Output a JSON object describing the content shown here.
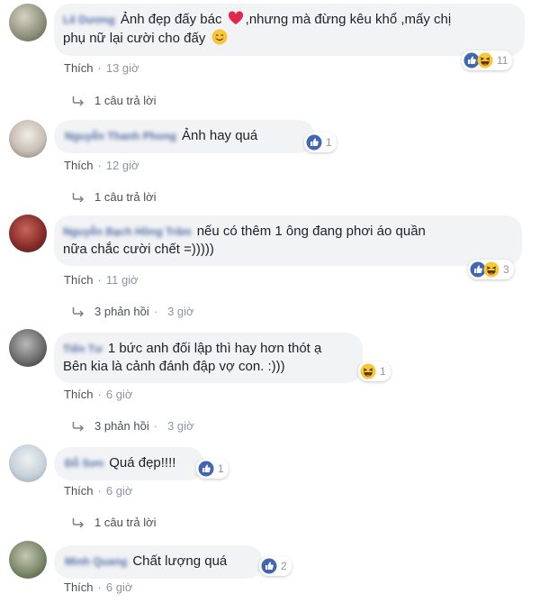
{
  "comments": [
    {
      "author": "Lê Dương",
      "text_line1": "Ảnh đẹp đấy bác",
      "emoji1": "❤️",
      "text_line1b": ",nhưng mà đừng kêu khổ ,mấy chị",
      "text_line2": "phụ nữ lại cười cho đấy",
      "emoji2": "😊",
      "reaction_count": "11",
      "like_label": "Thích",
      "time": "13 giờ",
      "replies_label": "1 câu trả lời"
    },
    {
      "author": "Nguyễn Thanh Phong",
      "text_line1": "Ảnh hay quá",
      "reaction_count": "1",
      "like_label": "Thích",
      "time": "12 giờ",
      "replies_label": "1 câu trả lời"
    },
    {
      "author": "Nguyễn Bạch Hồng Trâm",
      "text_line1": "nếu có thêm 1 ông đang phơi áo quần",
      "text_line2": "nữa chắc cười chết =)))))",
      "reaction_count": "3",
      "like_label": "Thích",
      "time": "11 giờ",
      "replies_label": "3 phản hồi",
      "replies_time": "3 giờ"
    },
    {
      "author": "Tiến Tư",
      "text_line1": "1 bức anh đối lập thì hay hơn thót ạ",
      "text_line2": "Bên kia là cảnh đánh đập vợ con. :)))",
      "reaction_count": "1",
      "like_label": "Thích",
      "time": "6 giờ",
      "replies_label": "3 phản hồi",
      "replies_time": "3 giờ"
    },
    {
      "author": "Đỗ Sơn",
      "text_line1": "Quá đẹp!!!!",
      "reaction_count": "1",
      "like_label": "Thích",
      "time": "6 giờ",
      "replies_label": "1 câu trả lời"
    },
    {
      "author": "Minh Quang",
      "text_line1": "Chất lượng quá",
      "reaction_count": "2",
      "like_label": "Thích",
      "time": "6 giờ"
    }
  ],
  "icons": {
    "like": "like-reaction-icon",
    "haha": "haha-reaction-icon",
    "reply_arrow": "reply-arrow-icon"
  },
  "colors": {
    "like_blue": "#4267b2",
    "haha_yellow": "#f7c736",
    "author_blue": "#385898",
    "bubble_bg": "#f2f3f5"
  }
}
